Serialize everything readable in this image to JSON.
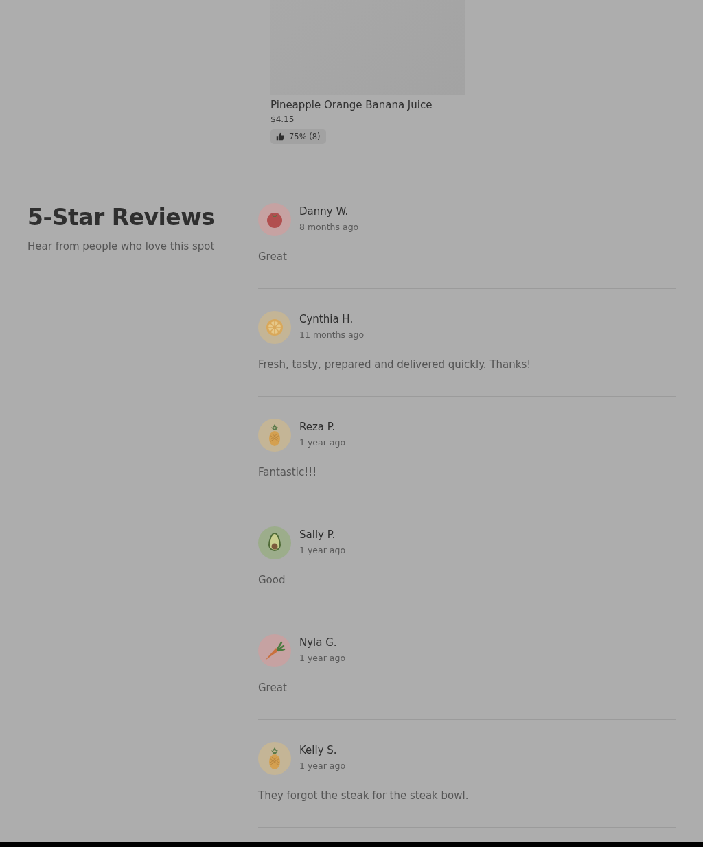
{
  "product": {
    "name": "Pineapple Orange Banana Juice",
    "price": "$4.15",
    "rating": "75% (8)"
  },
  "section": {
    "title": "5-Star Reviews",
    "subtitle": "Hear from people who love this spot"
  },
  "reviews": [
    {
      "name": "Danny W.",
      "time": "8 months ago",
      "text": "Great",
      "kind": "tomato"
    },
    {
      "name": "Cynthia H.",
      "time": "11 months ago",
      "text": "Fresh, tasty, prepared and delivered quickly. Thanks!",
      "kind": "orange"
    },
    {
      "name": "Reza P.",
      "time": "1 year ago",
      "text": "Fantastic!!!",
      "kind": "pineapple"
    },
    {
      "name": "Sally P.",
      "time": "1 year ago",
      "text": "Good",
      "kind": "avocado"
    },
    {
      "name": "Nyla G.",
      "time": "1 year ago",
      "text": "Great",
      "kind": "carrot"
    },
    {
      "name": "Kelly S.",
      "time": "1 year ago",
      "text": "They forgot the steak for the steak bowl.",
      "kind": "pineapple"
    }
  ]
}
